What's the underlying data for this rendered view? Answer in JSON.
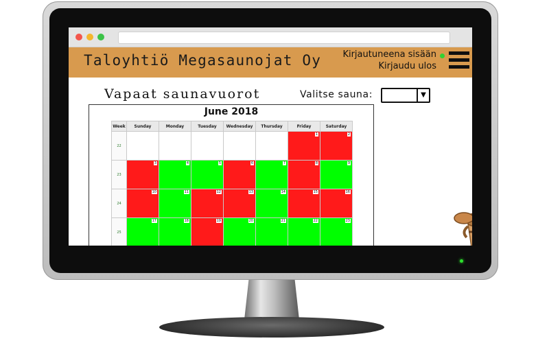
{
  "site": {
    "title": "Taloyhtiö Megasaunojat Oy",
    "login_status": "Kirjautuneena sisään",
    "logout_label": "Kirjaudu ulos"
  },
  "page": {
    "title": "Vapaat saunavuorot",
    "select_label": "Valitse sauna:",
    "select_value": ""
  },
  "calendar": {
    "title": "June 2018",
    "headers": [
      "Week",
      "Sunday",
      "Monday",
      "Tuesday",
      "Wednesday",
      "Thursday",
      "Friday",
      "Saturday"
    ],
    "weeks": [
      {
        "week": "22",
        "days": [
          {
            "date": "",
            "status": "empty"
          },
          {
            "date": "",
            "status": "empty"
          },
          {
            "date": "",
            "status": "empty"
          },
          {
            "date": "",
            "status": "empty"
          },
          {
            "date": "",
            "status": "empty"
          },
          {
            "date": "1",
            "status": "booked"
          },
          {
            "date": "2",
            "status": "booked"
          }
        ]
      },
      {
        "week": "23",
        "days": [
          {
            "date": "3",
            "status": "booked"
          },
          {
            "date": "4",
            "status": "free"
          },
          {
            "date": "5",
            "status": "free"
          },
          {
            "date": "6",
            "status": "booked"
          },
          {
            "date": "7",
            "status": "free"
          },
          {
            "date": "8",
            "status": "booked"
          },
          {
            "date": "9",
            "status": "free"
          }
        ]
      },
      {
        "week": "24",
        "days": [
          {
            "date": "10",
            "status": "booked"
          },
          {
            "date": "11",
            "status": "free"
          },
          {
            "date": "12",
            "status": "booked"
          },
          {
            "date": "13",
            "status": "booked"
          },
          {
            "date": "14",
            "status": "free"
          },
          {
            "date": "15",
            "status": "booked"
          },
          {
            "date": "16",
            "status": "booked"
          }
        ]
      },
      {
        "week": "25",
        "days": [
          {
            "date": "17",
            "status": "free"
          },
          {
            "date": "18",
            "status": "free"
          },
          {
            "date": "19",
            "status": "booked"
          },
          {
            "date": "20",
            "status": "free"
          },
          {
            "date": "21",
            "status": "free"
          },
          {
            "date": "22",
            "status": "free"
          },
          {
            "date": "23",
            "status": "free"
          }
        ]
      }
    ]
  },
  "colors": {
    "header_bg": "#d89a4e",
    "free": "#00ff00",
    "booked": "#ff1a1a",
    "online_dot": "#32d232"
  },
  "icons": {
    "menu": "hamburger-menu-icon",
    "select_arrow": "triangle-down-icon",
    "illustration": "sauna-bucket-ladle"
  }
}
